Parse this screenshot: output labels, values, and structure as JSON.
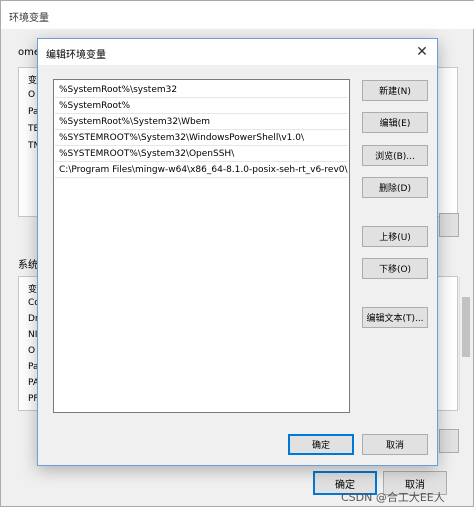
{
  "background": {
    "title": "环境变量",
    "user_section_label": "ome",
    "user_rows": [
      "变",
      "O",
      "Pa",
      "TE",
      "TN"
    ],
    "system_section_label": "系统",
    "system_rows": [
      "变",
      "Co",
      "Dr",
      "NI",
      "O",
      "Pa",
      "PA",
      "PF"
    ],
    "ok_label": "确定",
    "cancel_label": "取消"
  },
  "dialog": {
    "title": "编辑环境变量",
    "close_glyph": "✕",
    "paths": [
      "%SystemRoot%\\system32",
      "%SystemRoot%",
      "%SystemRoot%\\System32\\Wbem",
      "%SYSTEMROOT%\\System32\\WindowsPowerShell\\v1.0\\",
      "%SYSTEMROOT%\\System32\\OpenSSH\\",
      "C:\\Program Files\\mingw-w64\\x86_64-8.1.0-posix-seh-rt_v6-rev0\\..."
    ],
    "buttons": {
      "new": "新建(N)",
      "edit": "编辑(E)",
      "browse": "浏览(B)...",
      "delete": "删除(D)",
      "move_up": "上移(U)",
      "move_down": "下移(O)",
      "edit_text": "编辑文本(T)...",
      "ok": "确定",
      "cancel": "取消"
    }
  },
  "watermark": "CSDN @合工大EE人",
  "colors": {
    "accent": "#0078d7",
    "window_bg": "#f0f0f0"
  }
}
